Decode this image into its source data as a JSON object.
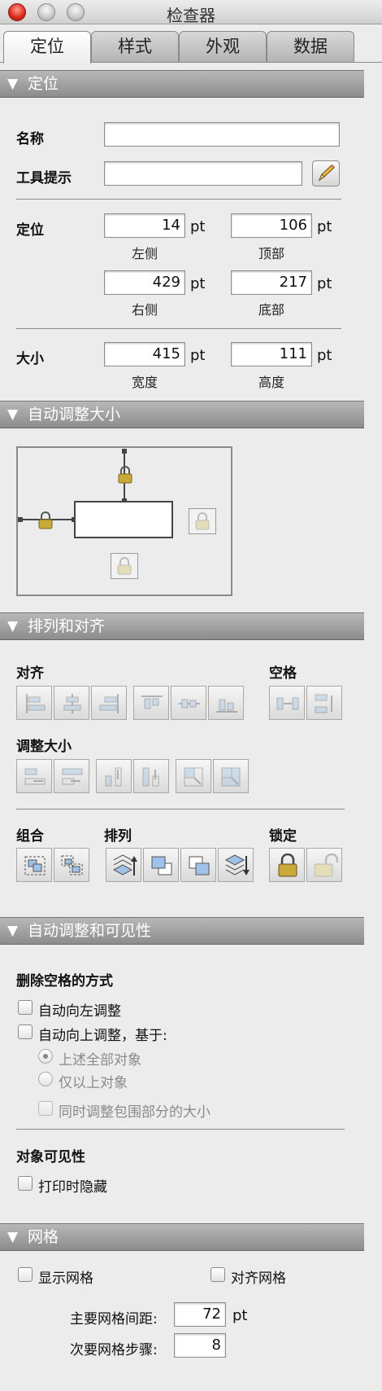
{
  "window": {
    "title": "检查器"
  },
  "tabs": [
    {
      "label": "定位"
    },
    {
      "label": "样式"
    },
    {
      "label": "外观"
    },
    {
      "label": "数据"
    }
  ],
  "sections": {
    "position": "定位",
    "autosize": "自动调整大小",
    "arrange": "排列和对齐",
    "visibility": "自动调整和可见性",
    "grid": "网格"
  },
  "position": {
    "name_label": "名称",
    "name_value": "",
    "tooltip_label": "工具提示",
    "tooltip_value": "",
    "pos_label": "定位",
    "left": "14",
    "left_label": "左侧",
    "top": "106",
    "top_label": "顶部",
    "right": "429",
    "right_label": "右侧",
    "bottom": "217",
    "bottom_label": "底部",
    "size_label": "大小",
    "width": "415",
    "width_label": "宽度",
    "height": "111",
    "height_label": "高度",
    "unit": "pt"
  },
  "arrange": {
    "align_label": "对齐",
    "space_label": "空格",
    "resize_label": "调整大小",
    "group_label": "组合",
    "order_label": "排列",
    "lock_label": "锁定"
  },
  "visibility": {
    "remove_space_label": "删除空格的方式",
    "auto_left": "自动向左调整",
    "auto_up": "自动向上调整，基于:",
    "all_above": "上述全部对象",
    "only_above": "仅以上对象",
    "resize_enclosing": "同时调整包围部分的大小",
    "obj_visibility_label": "对象可见性",
    "hide_print": "打印时隐藏"
  },
  "grid": {
    "show_grid": "显示网格",
    "snap_grid": "对齐网格",
    "major_label": "主要网格间距:",
    "major_value": "72",
    "major_unit": "pt",
    "minor_label": "次要网格步骤:",
    "minor_value": "8"
  },
  "colors": {
    "lock_gold": "#c9a93a",
    "section_header": "#9a9a9a",
    "accent_blue": "#9fc3e8"
  }
}
